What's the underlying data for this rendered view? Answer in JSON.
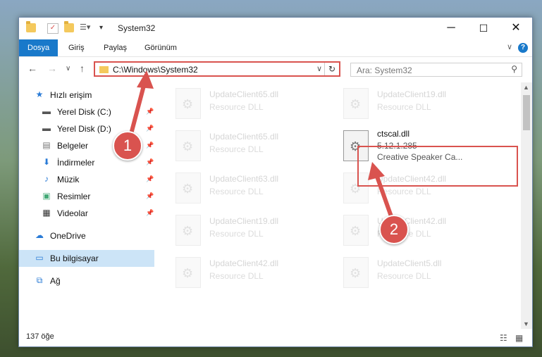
{
  "window": {
    "title": "System32"
  },
  "ribbon": {
    "tabs": [
      "Dosya",
      "Giriş",
      "Paylaş",
      "Görünüm"
    ],
    "help": "?"
  },
  "address": {
    "path": "C:\\Windows\\System32"
  },
  "search": {
    "placeholder": "Ara: System32"
  },
  "sidebar": {
    "quick_access": "Hızlı erişim",
    "items": [
      {
        "label": "Yerel Disk (C:)",
        "icon": "drive-icon"
      },
      {
        "label": "Yerel Disk (D:)",
        "icon": "drive-icon"
      },
      {
        "label": "Belgeler",
        "icon": "documents-icon"
      },
      {
        "label": "İndirmeler",
        "icon": "downloads-icon"
      },
      {
        "label": "Müzik",
        "icon": "music-icon"
      },
      {
        "label": "Resimler",
        "icon": "pictures-icon"
      },
      {
        "label": "Videolar",
        "icon": "videos-icon"
      }
    ],
    "onedrive": "OneDrive",
    "this_pc": "Bu bilgisayar",
    "network": "Ağ"
  },
  "files": [
    {
      "name": "UpdateClient65.dll",
      "desc": "Resource DLL"
    },
    {
      "name": "UpdateClient19.dll",
      "desc": "Resource DLL"
    },
    {
      "name": "UpdateClient65.dll",
      "desc": "Resource DLL"
    },
    {
      "name": "ctscal.dll",
      "version": "5.12.1.285",
      "desc": "Creative Speaker Ca..."
    },
    {
      "name": "UpdateClient63.dll",
      "desc": "Resource DLL"
    },
    {
      "name": "UpdateClient42.dll",
      "desc": "Resource DLL"
    },
    {
      "name": "UpdateClient19.dll",
      "desc": "Resource DLL"
    },
    {
      "name": "UpdateClient42.dll",
      "desc": "Resource DLL"
    },
    {
      "name": "UpdateClient42.dll",
      "desc": "Resource DLL"
    },
    {
      "name": "UpdateClient5.dll",
      "desc": "Resource DLL"
    }
  ],
  "status": {
    "count": "137 öğe"
  },
  "annotations": {
    "badge1": "1",
    "badge2": "2",
    "color": "#d9534f"
  }
}
